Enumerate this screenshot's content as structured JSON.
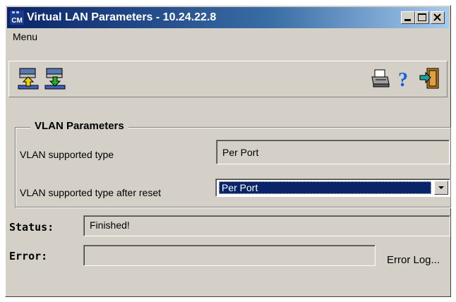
{
  "window": {
    "app_icon_text": "CM",
    "title": "Virtual LAN Parameters - 10.24.22.8"
  },
  "menubar": {
    "menu_label": "Menu"
  },
  "toolbar": {
    "buttons": [
      "upload-icon",
      "download-icon",
      "print-icon",
      "help-icon",
      "exit-icon"
    ]
  },
  "vlan_parameters": {
    "group_title": "VLAN Parameters",
    "supported_type_label": "VLAN supported type",
    "supported_type_value": "Per Port",
    "after_reset_label": "VLAN supported type after reset",
    "after_reset_value": "Per Port"
  },
  "status": {
    "label": "Status:",
    "value": "Finished!"
  },
  "error": {
    "label": "Error:",
    "value": "",
    "log_button": "Error Log..."
  },
  "colors": {
    "title_gradient_start": "#0a246a",
    "window_bg": "#d4d0c8",
    "selection": "#0a246a"
  }
}
